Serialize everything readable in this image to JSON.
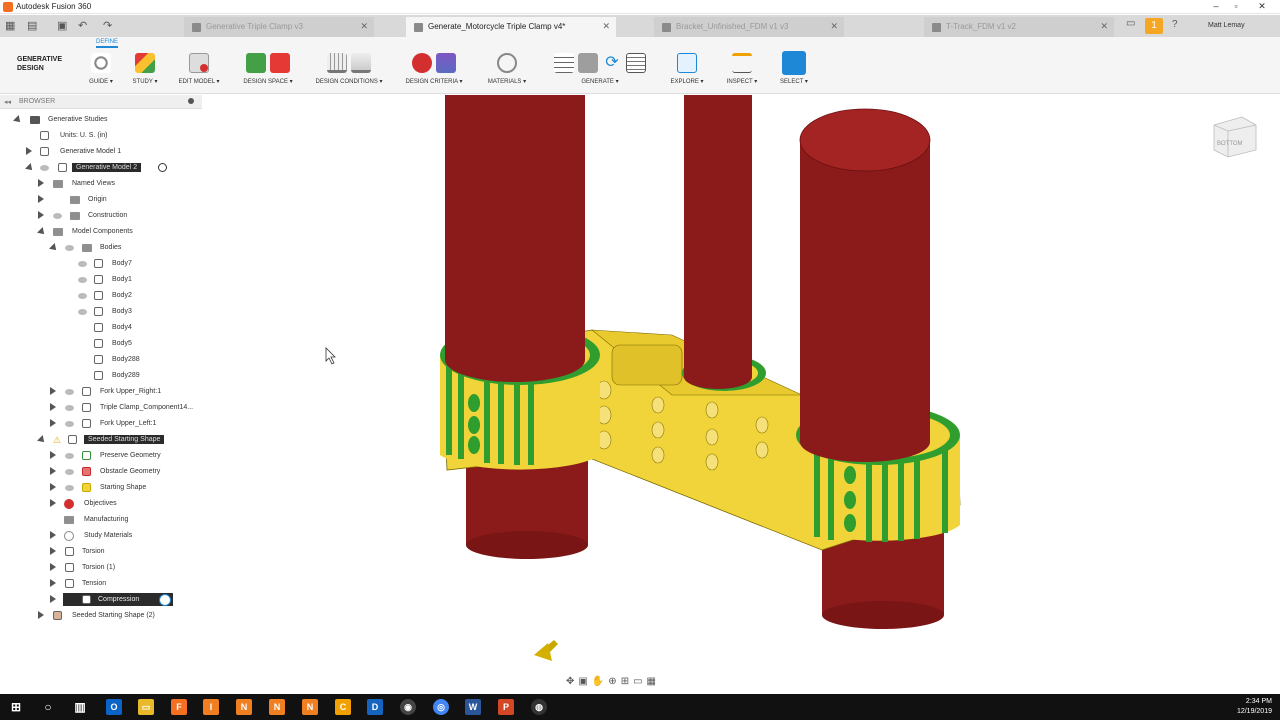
{
  "window": {
    "title": "Autodesk Fusion 360"
  },
  "tabs": [
    {
      "label": "Generative Triple Clamp v3",
      "active": false
    },
    {
      "label": "Generate_Motorcycle Triple Clamp v4*",
      "active": true
    },
    {
      "label": "Bracket_Unfinished_FDM v1 v3",
      "active": false
    },
    {
      "label": "T-Track_FDM v1 v2",
      "active": false
    }
  ],
  "user": {
    "name": "Matt Lemay",
    "notifications": "1"
  },
  "toolbar": {
    "workspace": "GENERATIVE\nDESIGN",
    "workspace_tab": "DEFINE",
    "groups": [
      {
        "label": "GUIDE ▾"
      },
      {
        "label": "STUDY ▾"
      },
      {
        "label": "EDIT MODEL ▾"
      },
      {
        "label": "DESIGN SPACE ▾"
      },
      {
        "label": "DESIGN CONDITIONS ▾"
      },
      {
        "label": "DESIGN CRITERIA ▾"
      },
      {
        "label": "MATERIALS ▾"
      },
      {
        "label": "GENERATE ▾"
      },
      {
        "label": "EXPLORE ▾"
      },
      {
        "label": "INSPECT ▾"
      },
      {
        "label": "SELECT ▾"
      }
    ]
  },
  "browser": {
    "title": "BROWSER",
    "items": [
      {
        "label": "Generative Studies"
      },
      {
        "label": "Units: U. S. (in)"
      },
      {
        "label": "Generative Model 1"
      },
      {
        "label": "Generative Model 2"
      },
      {
        "label": "Named Views"
      },
      {
        "label": "Origin"
      },
      {
        "label": "Construction"
      },
      {
        "label": "Model Components"
      },
      {
        "label": "Bodies"
      },
      {
        "label": "Body7"
      },
      {
        "label": "Body1"
      },
      {
        "label": "Body2"
      },
      {
        "label": "Body3"
      },
      {
        "label": "Body4"
      },
      {
        "label": "Body5"
      },
      {
        "label": "Body288"
      },
      {
        "label": "Body289"
      },
      {
        "label": "Fork Upper_Right:1"
      },
      {
        "label": "Triple Clamp_Component14..."
      },
      {
        "label": "Fork Upper_Left:1"
      },
      {
        "label": "Seeded Starting Shape"
      },
      {
        "label": "Preserve Geometry"
      },
      {
        "label": "Obstacle Geometry"
      },
      {
        "label": "Starting Shape"
      },
      {
        "label": "Objectives"
      },
      {
        "label": "Manufacturing"
      },
      {
        "label": "Study Materials"
      },
      {
        "label": "Torsion"
      },
      {
        "label": "Torsion (1)"
      },
      {
        "label": "Tension"
      },
      {
        "label": "Compression"
      },
      {
        "label": "Seeded Starting Shape (2)"
      }
    ]
  },
  "viewcube": {
    "face": "BOTTOM"
  },
  "taskbar": {
    "time": "2:34 PM",
    "date": "12/19/2019"
  },
  "colors": {
    "preserve": "#7f1d1d",
    "obstacle": "#2f9e2f",
    "starting": "#f0d43a",
    "accent": "#1e88d6"
  }
}
